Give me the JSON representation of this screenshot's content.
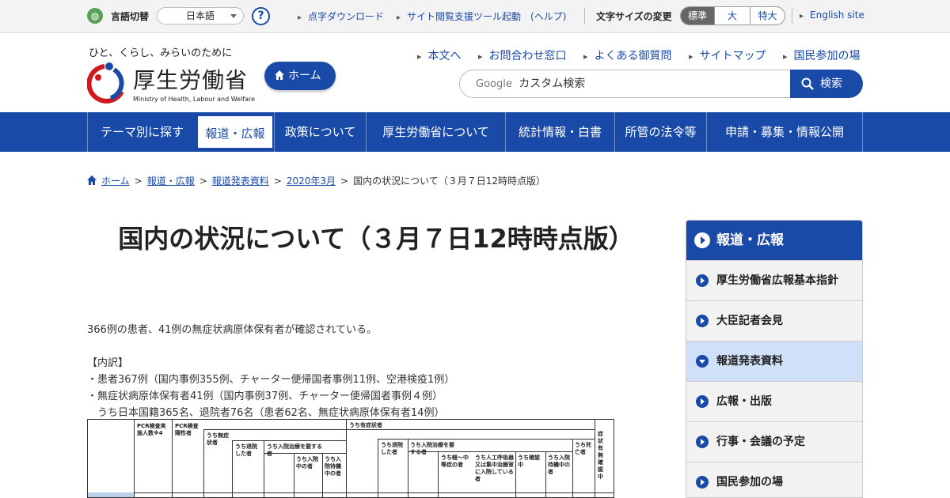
{
  "utility": {
    "language_label": "言語切替",
    "language_selected": "日本語",
    "help_label": "?",
    "links": [
      "点字ダウンロード",
      "サイト閲覧支援ツール起動　(ヘルプ)"
    ],
    "font_size_label": "文字サイズの変更",
    "font_sizes": [
      "標準",
      "大",
      "特大"
    ],
    "english_link": "English site"
  },
  "header": {
    "tagline": "ひと、くらし、みらいのために",
    "logo_text": "厚生労働省",
    "logo_en": "Ministry of Health, Labour and Welfare",
    "home_button": "ホーム",
    "nav_links": [
      "本文へ",
      "お問合わせ窓口",
      "よくある御質問",
      "サイトマップ",
      "国民参加の場"
    ],
    "search_brand": "Google",
    "search_placeholder": "カスタム検索",
    "search_button": "検索"
  },
  "global_nav": [
    "テーマ別に探す",
    "報道・広報",
    "政策について",
    "厚生労働省について",
    "統計情報・白書",
    "所管の法令等",
    "申請・募集・情報公開"
  ],
  "breadcrumb": {
    "links": [
      "ホーム",
      "報道・広報",
      "報道発表資料",
      "2020年3月"
    ],
    "current": "国内の状況について（３月７日12時時点版）"
  },
  "main": {
    "title": "国内の状況について（３月７日12時時点版）",
    "summary": "366例の患者、41例の無症状病原体保有者が確認されている。",
    "breakdown_heading": "【内訳】",
    "breakdown_lines": [
      "・患者367例（国内事例355例、チャーター便帰国者事例11例、空港検疫1例）",
      "・無症状病原体保有者41例（国内事例37例、チャーター便帰国者事例４例）",
      "　うち日本国籍365名、退院者76名（患者62名、無症状病原体保有者14例）"
    ],
    "table_headers": {
      "pcr_tested": "PCR検査実施人数※4",
      "pcr_positive": "PCR検査陽性者",
      "asymptomatic": "うち無症状者",
      "discharged_1": "うち退院した者",
      "needs_hosp_1": "うち入院治療を要する者",
      "hospitalized_1": "うち入院中の者",
      "waiting_1": "うち入院待機中の者",
      "symptomatic": "うち有症状者",
      "discharged_2": "うち退院した者",
      "needs_hosp_2": "うち入院治療を要する者",
      "mild": "うち軽～中等症の者",
      "ventilator": "うち人工呼吸器又は集中治療室に入院している者",
      "confirming": "うち確認中",
      "waiting_2": "うち入院待機中の者",
      "deaths": "うち死亡者",
      "unconfirmed": "症状有無確認中"
    }
  },
  "sidebar": {
    "heading": "報道・広報",
    "items": [
      "厚生労働省広報基本指針",
      "大臣記者会見",
      "報道発表資料",
      "広報・出版",
      "行事・会議の予定",
      "国民参加の場"
    ],
    "current_index": 2
  },
  "colors": {
    "brand_blue": "#1a4aa8",
    "sidebar_current": "#cfe0f8"
  }
}
